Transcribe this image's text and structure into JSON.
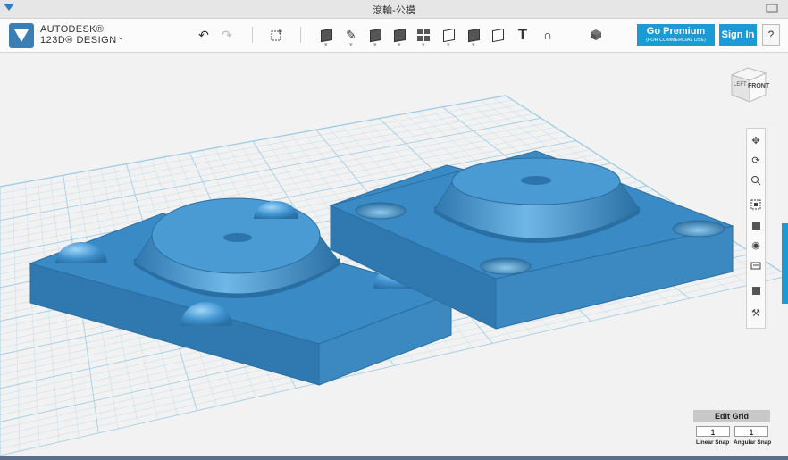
{
  "window": {
    "title": "滾輪-公模"
  },
  "brand": {
    "line1": "AUTODESK®",
    "line2": "123D® DESIGN",
    "menu_icon": "chevron-down-icon"
  },
  "toolbar": {
    "undo_icon": "undo-icon",
    "redo_icon": "redo-icon",
    "tools": [
      "transform",
      "primitives",
      "sketch",
      "construct",
      "modify",
      "pattern",
      "grouping",
      "combine",
      "measure",
      "text",
      "snap",
      "material"
    ]
  },
  "premium": {
    "label": "Go Premium",
    "sublabel": "(FOR COMMERCIAL USE)"
  },
  "signin": {
    "label": "Sign In"
  },
  "help": {
    "label": "?"
  },
  "viewcube": {
    "left": "LEFT",
    "front": "FRONT"
  },
  "navbar": {
    "items": [
      "pan",
      "orbit",
      "zoom",
      "fit",
      "view-cube",
      "visibility",
      "material",
      "snap",
      "settings"
    ]
  },
  "editgrid": {
    "label": "Edit Grid",
    "linear_value": "1",
    "angular_value": "1",
    "linear_label": "Linear Snap",
    "angular_label": "Angular Snap"
  },
  "colors": {
    "accent": "#1b9ad6",
    "model": "#3f93d0",
    "grid": "#9ccbe3"
  }
}
